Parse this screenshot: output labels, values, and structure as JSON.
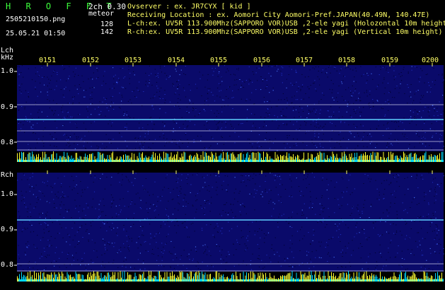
{
  "header": {
    "logo": "H R O F F T",
    "version": "2ch 0.30",
    "filename": "2505210150.png",
    "datetime": "25.05.21 01:50",
    "meteor_label": "meteor",
    "lch_count": "128",
    "rch_count": "142"
  },
  "info": {
    "observer": "Ovserver           : ex. JR7CYX [ kid ]",
    "location": "Receiving Location : ex. Aomori City Aomori-Pref.JAPAN(40.49N, 140.47E)",
    "lch": "L-ch:ex. UV5R 113.900Mhz(SAPPORO VOR)USB ,2-ele yagi (Holozontal 10m height)",
    "rch": "R-ch:ex. UV5R 113.900Mhz(SAPPORO VOR)USB ,2-ele yagi (Vertical 10m height)"
  },
  "time_ticks": [
    "0151",
    "0152",
    "0153",
    "0154",
    "0155",
    "0156",
    "0157",
    "0158",
    "0159",
    "0200"
  ],
  "lch_panel": {
    "label": "Lch",
    "unit": "kHz",
    "freq_labels": [
      "1.0",
      "0.9",
      "0.8"
    ]
  },
  "rch_panel": {
    "label": "Rch",
    "freq_labels": [
      "1.0",
      "0.9",
      "0.8"
    ]
  },
  "colors": {
    "logo": "#3cff3c",
    "info_text": "#ffff66",
    "spectrum_bg": "#0a0a6a",
    "carrier_line": "#5fd0ff",
    "bar_yellow": "#ffff33",
    "bar_cyan": "#00d8ff"
  }
}
